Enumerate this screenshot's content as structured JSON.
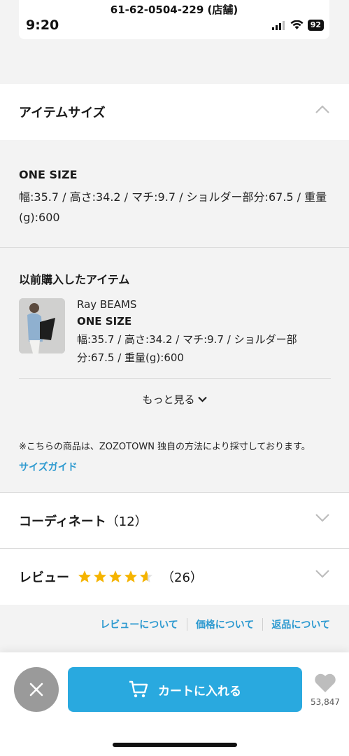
{
  "status": {
    "phone": "61-62-0504-229 (店舗)",
    "time": "9:20",
    "battery": "92"
  },
  "item_size": {
    "title": "アイテムサイズ",
    "size_name": "ONE SIZE",
    "detail_line1": "幅:35.7 / 高さ:34.2 / マチ:9.7 / ショルダー部分:67.5 / 重量",
    "detail_line2": "(g):600"
  },
  "previous": {
    "title": "以前購入したアイテム",
    "brand": "Ray BEAMS",
    "size_name": "ONE SIZE",
    "detail_line1": "幅:35.7 / 高さ:34.2 / マチ:9.7 / ショルダー部",
    "detail_line2": "分:67.5 / 重量(g):600",
    "more": "もっと見る"
  },
  "note": "※こちらの商品は、ZOZOTOWN 独自の方法により採寸しております。",
  "size_guide": "サイズガイド",
  "coordinate": {
    "label": "コーディネート",
    "count": "（12）"
  },
  "review": {
    "label": "レビュー",
    "rating": 4.6,
    "count": "（26）"
  },
  "links": [
    "レビューについて",
    "価格について",
    "返品について"
  ],
  "bottom": {
    "cart_label": "カートに入れる",
    "fav_count": "53,847"
  },
  "colors": {
    "accent": "#29a9df",
    "star": "#f5b400"
  }
}
